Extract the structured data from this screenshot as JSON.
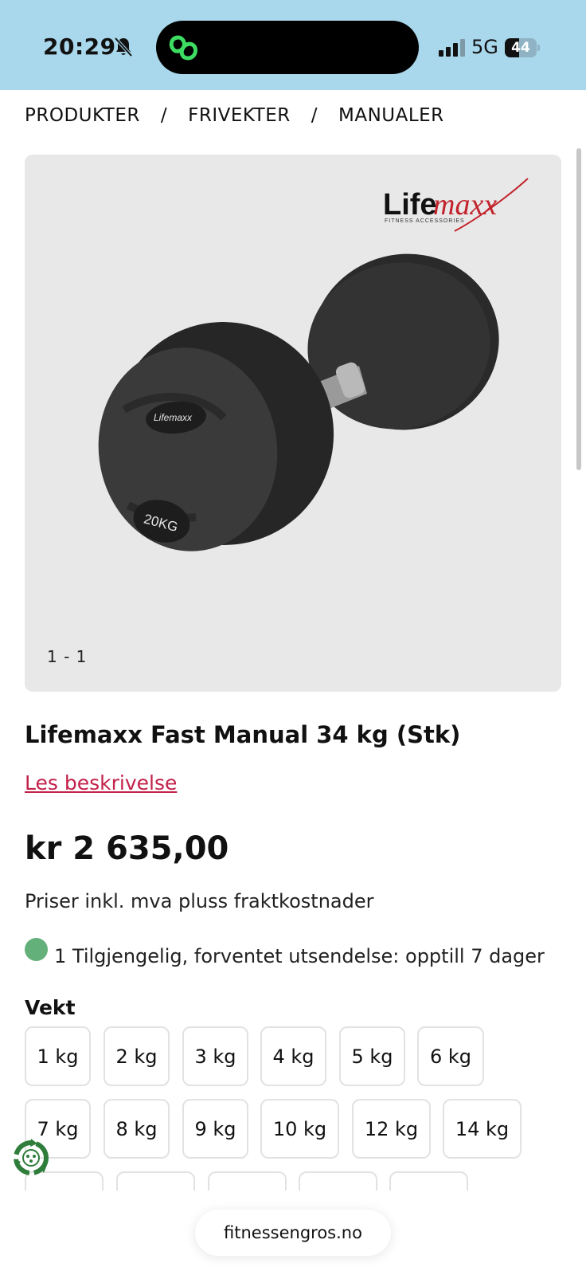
{
  "status_bar": {
    "time": "20:29",
    "network": "5G",
    "battery_percent": "44",
    "battery_level": 0.44,
    "icons": [
      "bell-muted-icon",
      "app-logo-icon",
      "signal-icon",
      "battery-icon"
    ]
  },
  "breadcrumb": [
    "PRODUKTER",
    "FRIVEKTER",
    "MANUALER"
  ],
  "breadcrumb_separator": "/",
  "gallery": {
    "counter": "1 - 1",
    "brand_logo": "Lifemaxx",
    "brand_tagline": "FITNESS ACCESSORIES",
    "dumbbell_label": "20KG",
    "dumbbell_brand": "Lifemaxx"
  },
  "product": {
    "title": "Lifemaxx Fast Manual 34 kg (Stk)",
    "description_link": "Les beskrivelse",
    "price": "kr 2 635,00",
    "price_note": "Priser inkl. mva pluss fraktkostnader",
    "stock_text": "1 Tilgjengelig, forventet utsendelse: opptill 7 dager",
    "stock_color": "#63b07a",
    "weight_label": "Vekt",
    "weights_row1": [
      "1 kg",
      "2 kg",
      "3 kg",
      "4 kg",
      "5 kg",
      "6 kg"
    ],
    "weights_row2": [
      "7 kg",
      "8 kg",
      "9 kg",
      "10 kg",
      "12 kg",
      "14 kg"
    ]
  },
  "footer": {
    "domain": "fitnessengros.no"
  },
  "colors": {
    "status_bar_bg": "#a9d8ec",
    "link": "#c3224a",
    "recycle_green": "#2e7d3a"
  }
}
